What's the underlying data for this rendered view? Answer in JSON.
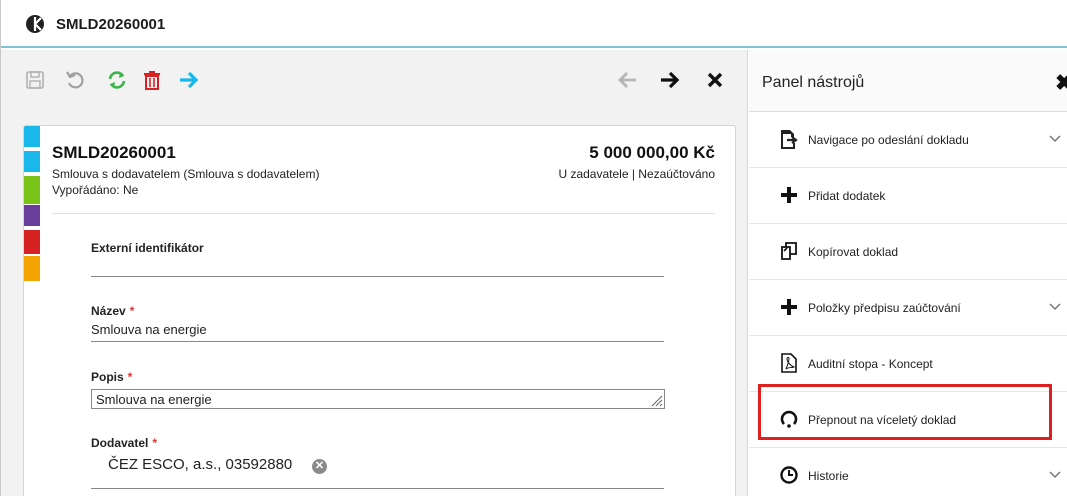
{
  "window": {
    "title": "SMLD20260001"
  },
  "toolbar": {
    "save_icon": "save-icon",
    "undo_icon": "undo-icon",
    "refresh_icon": "refresh-icon",
    "delete_icon": "trash-icon",
    "forward_icon": "arrow-right-icon",
    "prev_icon": "arrow-left-icon",
    "next_icon": "arrow-right-icon",
    "close_icon": "close-icon"
  },
  "document": {
    "code": "SMLD20260001",
    "type": "Smlouva s dodavatelem (Smlouva s dodavatelem)",
    "settled": "Vypořádáno: Ne",
    "amount": "5 000 000,00 Kč",
    "state": "U zadavatele | Nezaúčtováno",
    "stripe_colors": [
      "#1ab7ea",
      "#1ab7ea",
      "#7ac41a",
      "#6a3d9a",
      "#d62222",
      "#f5a300"
    ]
  },
  "form": {
    "external_id": {
      "label": "Externí identifikátor",
      "value": ""
    },
    "name": {
      "label": "Název",
      "required_mark": "*",
      "value": "Smlouva na energie"
    },
    "description": {
      "label": "Popis",
      "required_mark": "*",
      "value": "Smlouva na energie"
    },
    "supplier": {
      "label": "Dodavatel",
      "required_mark": "*",
      "value": "ČEZ ESCO, a.s., 03592880",
      "clear_glyph": "✕"
    }
  },
  "panel": {
    "title": "Panel nástrojů",
    "close_glyph": "✖",
    "items": [
      {
        "label": "Navigace po odeslání dokladu",
        "icon": "send-document-icon",
        "expandable": true
      },
      {
        "label": "Přidat dodatek",
        "icon": "plus-icon",
        "expandable": false
      },
      {
        "label": "Kopírovat doklad",
        "icon": "copy-icon",
        "expandable": false
      },
      {
        "label": "Položky předpisu zaúčtování",
        "icon": "plus-icon",
        "expandable": true
      },
      {
        "label": "Auditní stopa - Koncept",
        "icon": "pdf-icon",
        "expandable": false
      },
      {
        "label": "Přepnout na víceletý doklad",
        "icon": "cycle-icon",
        "expandable": false
      },
      {
        "label": "Historie",
        "icon": "clock-icon",
        "expandable": true
      }
    ]
  },
  "colors": {
    "accent_line": "#7fc3d6",
    "refresh": "#3cb44b",
    "delete": "#d62222",
    "forward": "#1ab7ea",
    "highlight": "#e02020"
  }
}
